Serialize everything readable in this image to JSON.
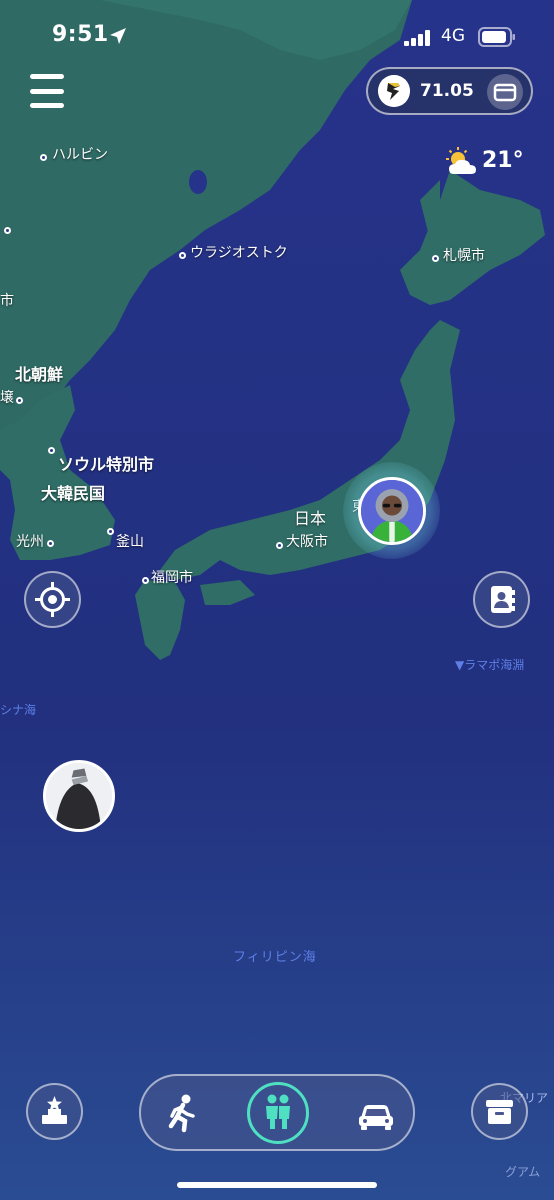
{
  "status_bar": {
    "time": "9:51",
    "network": "4G"
  },
  "wallet": {
    "balance": "71.05"
  },
  "weather": {
    "temperature": "21°",
    "icon": "partly-cloudy-icon"
  },
  "map": {
    "cities": [
      {
        "name": "ハルビン"
      },
      {
        "name": "ウラジオストク"
      },
      {
        "name": "札幌市"
      },
      {
        "name": "ソウル特別市"
      },
      {
        "name": "光州"
      },
      {
        "name": "釜山"
      },
      {
        "name": "福岡市"
      },
      {
        "name": "大阪市"
      }
    ],
    "countries": [
      {
        "name": "北朝鮮"
      },
      {
        "name": "大韓民国"
      },
      {
        "name": "日本"
      }
    ],
    "seas": [
      {
        "name": "▼ラマポ海淵"
      },
      {
        "name": "シナ海"
      },
      {
        "name": "フィリピン海"
      },
      {
        "name": "北マリア"
      },
      {
        "name": "グアム"
      }
    ],
    "edge_fragments": [
      {
        "text": "壌"
      },
      {
        "text": "市"
      },
      {
        "text": "東"
      }
    ]
  },
  "controls": {
    "menu_icon": "hamburger-menu-icon",
    "recenter_icon": "crosshair-target-icon",
    "contacts_icon": "contact-book-icon",
    "leaderboard_icon": "podium-star-icon",
    "inventory_icon": "storage-box-icon"
  },
  "modes": [
    {
      "id": "walk",
      "icon": "walking-person-icon"
    },
    {
      "id": "together",
      "icon": "two-people-icon",
      "selected": true
    },
    {
      "id": "car",
      "icon": "car-icon"
    }
  ],
  "colors": {
    "sea": "#1f2e7e",
    "land": "#2f6d6a",
    "selected_mode": "#4fe0c2",
    "sea_label": "#5d7fe6"
  }
}
